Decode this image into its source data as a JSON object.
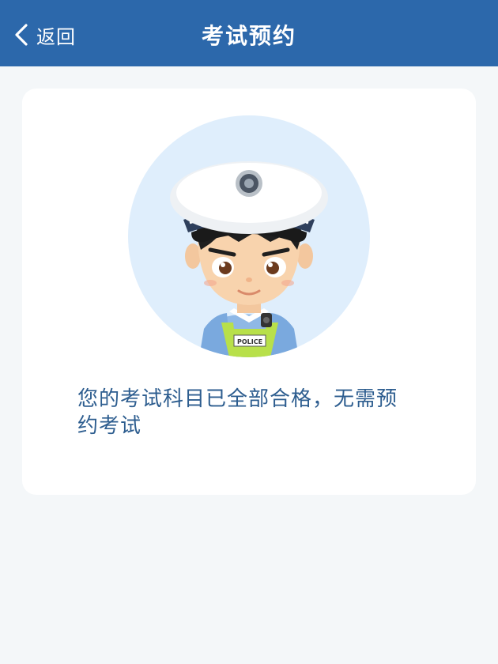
{
  "header": {
    "back_label": "返回",
    "title": "考试预约",
    "background_color": "#2c68ab"
  },
  "card": {
    "illustration": {
      "name": "traffic-police-avatar",
      "badge_text": "POLICE",
      "background_color": "#dfeefc"
    },
    "message": "您的考试科目已全部合格，无需预约考试",
    "message_color": "#2d5d8f"
  }
}
